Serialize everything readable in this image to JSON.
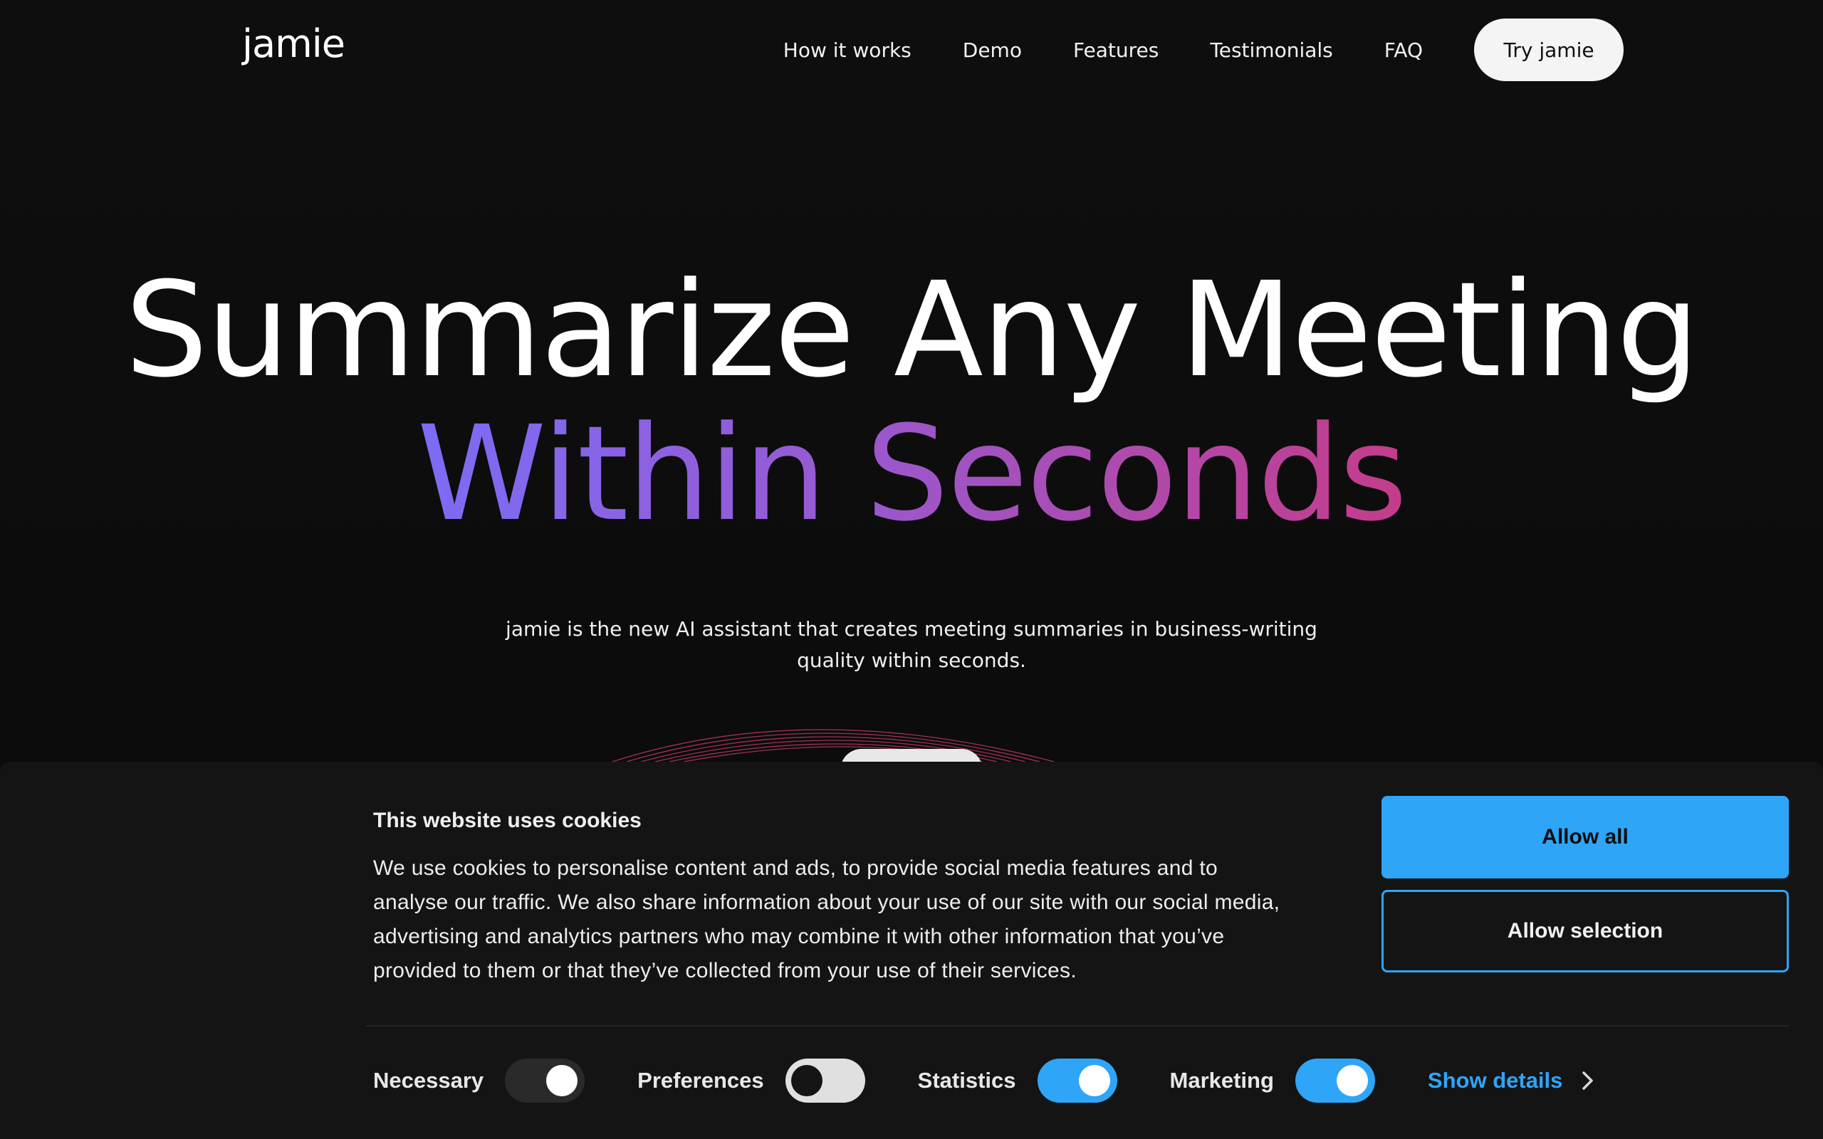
{
  "header": {
    "logo": "jamie",
    "nav": [
      "How it works",
      "Demo",
      "Features",
      "Testimonials",
      "FAQ"
    ],
    "cta": "Try jamie"
  },
  "hero": {
    "line1": "Summarize Any Meeting",
    "line2": "Within Seconds",
    "subtitle": "jamie is the new AI assistant that creates meeting summaries in business-writing quality within seconds."
  },
  "cookie_banner": {
    "title": "This website uses cookies",
    "text": "We use cookies to personalise content and ads, to provide social media features and to analyse our traffic. We also share information about your use of our site with our social media, advertising and analytics partners who may combine it with other information that you’ve provided to them or that they’ve collected from your use of their services.",
    "allow_all": "Allow all",
    "allow_selection": "Allow selection",
    "toggles": [
      {
        "label": "Necessary",
        "state": "on",
        "locked": true
      },
      {
        "label": "Preferences",
        "state": "off"
      },
      {
        "label": "Statistics",
        "state": "on"
      },
      {
        "label": "Marketing",
        "state": "on"
      }
    ],
    "show_details": "Show details"
  },
  "colors": {
    "accent_blue": "#2ea5f7",
    "gradient_start": "#7c6cf5",
    "gradient_end": "#c43c8a",
    "background": "#0c0c0c"
  },
  "icons": [
    "chevron-right-icon"
  ]
}
